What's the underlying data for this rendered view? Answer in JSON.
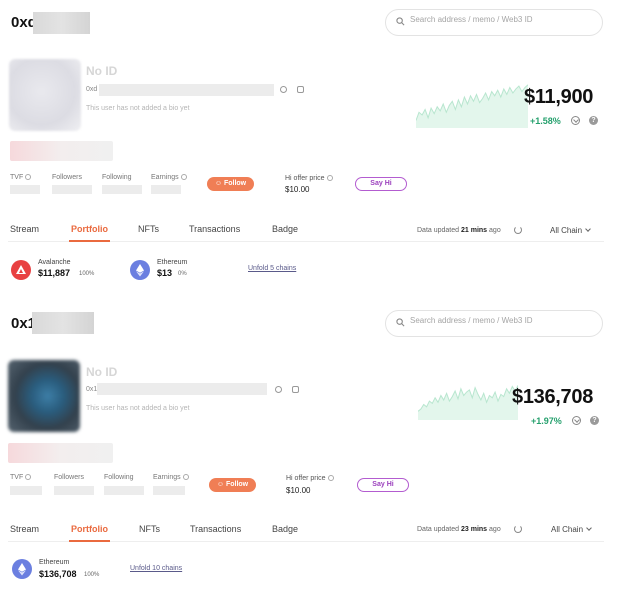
{
  "search_placeholder": "Search address / memo / Web3 ID",
  "profiles": [
    {
      "address_prefix": "0xd",
      "no_id": "No ID",
      "short_address": "0xd",
      "bio": "This user has not added a bio yet",
      "net_worth": "$11,900",
      "change": "+1.58%",
      "stats": {
        "tvf": "TVF",
        "followers": "Followers",
        "following": "Following",
        "earnings": "Earnings"
      },
      "follow_label": "Follow",
      "offer_label": "Hi offer price",
      "offer_value": "$10.00",
      "say_hi": "Say Hi",
      "tabs": [
        "Stream",
        "Portfolio",
        "NFTs",
        "Transactions",
        "Badge"
      ],
      "active_tab": "Portfolio",
      "updated_prefix": "Data updated",
      "updated_time": "21 mins",
      "updated_suffix": "ago",
      "chain_select": "All Chain",
      "chains": [
        {
          "name": "Avalanche",
          "value": "$11,887",
          "pct": "100%",
          "icon": "avalanche-icon",
          "color": "#e84142"
        },
        {
          "name": "Ethereum",
          "value": "$13",
          "pct": "0%",
          "icon": "ethereum-icon",
          "color": "#6274d8"
        }
      ],
      "unfold": "Unfold 5 chains",
      "spark": [
        36,
        30,
        32,
        28,
        34,
        27,
        31,
        26,
        29,
        24,
        30,
        25,
        22,
        28,
        21,
        26,
        19,
        24,
        18,
        22,
        17,
        23,
        20,
        16,
        21,
        15,
        18,
        14,
        19,
        13,
        17,
        12,
        16,
        13,
        11,
        15,
        12,
        10
      ]
    },
    {
      "address_prefix": "0x1",
      "no_id": "No ID",
      "short_address": "0x1",
      "bio": "This user has not added a bio yet",
      "net_worth": "$136,708",
      "change": "+1.97%",
      "stats": {
        "tvf": "TVF",
        "followers": "Followers",
        "following": "Following",
        "earnings": "Earnings"
      },
      "follow_label": "Follow",
      "offer_label": "Hi offer price",
      "offer_value": "$10.00",
      "say_hi": "Say Hi",
      "tabs": [
        "Stream",
        "Portfolio",
        "NFTs",
        "Transactions",
        "Badge"
      ],
      "active_tab": "Portfolio",
      "updated_prefix": "Data updated",
      "updated_time": "23 mins",
      "updated_suffix": "ago",
      "chain_select": "All Chain",
      "chains": [
        {
          "name": "Ethereum",
          "value": "$136,708",
          "pct": "100%",
          "icon": "ethereum-icon",
          "color": "#6274d8"
        }
      ],
      "unfold": "Unfold 10 chains",
      "spark": [
        34,
        32,
        28,
        30,
        25,
        27,
        22,
        26,
        20,
        24,
        18,
        25,
        21,
        16,
        23,
        14,
        20,
        17,
        15,
        22,
        13,
        19,
        24,
        18,
        26,
        20,
        22,
        17,
        25,
        19,
        21,
        14,
        18,
        12,
        16,
        11
      ]
    }
  ]
}
